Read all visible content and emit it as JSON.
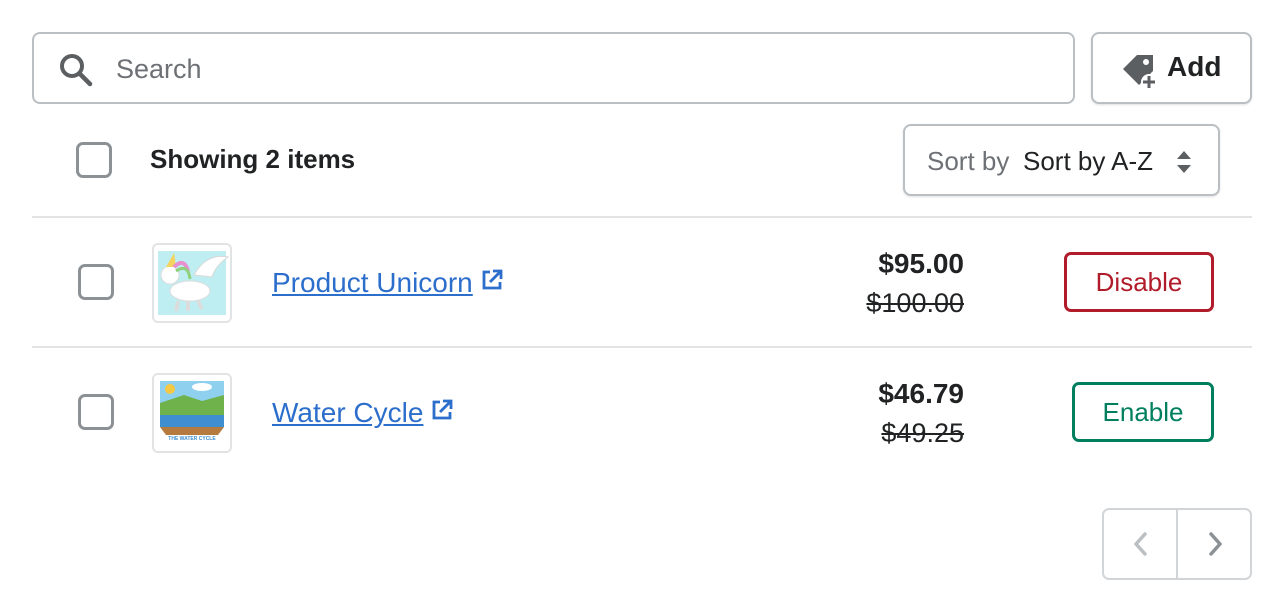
{
  "search": {
    "placeholder": "Search",
    "value": ""
  },
  "toolbar": {
    "add_label": "Add"
  },
  "list_header": {
    "showing_text": "Showing 2 items",
    "sort_prefix": "Sort by",
    "sort_value": "Sort by A-Z"
  },
  "products": [
    {
      "name": "Product Unicorn",
      "price": "$95.00",
      "compare_price": "$100.00",
      "action_label": "Disable",
      "action_color": "#b11c2a",
      "thumb_icon": "unicorn-image"
    },
    {
      "name": "Water Cycle",
      "price": "$46.79",
      "compare_price": "$49.25",
      "action_label": "Enable",
      "action_color": "#007f5f",
      "thumb_icon": "water-cycle-image",
      "thumb_caption": "THE WATER CYCLE"
    }
  ],
  "colors": {
    "link": "#2c6ecb",
    "border": "#babfc3",
    "danger": "#b11c2a",
    "success": "#007f5f"
  }
}
